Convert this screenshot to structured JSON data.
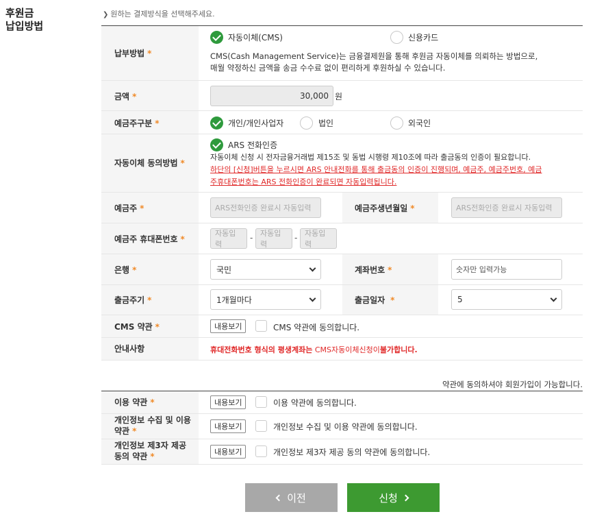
{
  "section_title_line1": "후원금",
  "section_title_line2": "납입방법",
  "hint": "원하는 결제방식을 선택해주세요.",
  "payment": {
    "label": "납부방법",
    "opt_cms": "자동이체(CMS)",
    "opt_card": "신용카드",
    "desc_line1": "CMS(Cash Management Service)는 금융결제원을 통해 후원금 자동이체를 의뢰하는 방법으로,",
    "desc_line2": "매월 약정하신 금액을 송금 수수료 없이 편리하게 후원하실 수 있습니다."
  },
  "amount": {
    "label": "금액",
    "value": "30,000",
    "unit": "원"
  },
  "depositor_type": {
    "label": "예금주구분",
    "opt_personal": "개인/개인사업자",
    "opt_corp": "법인",
    "opt_foreign": "외국인"
  },
  "consent_method": {
    "label": "자동이체 동의방법",
    "opt_ars": "ARS 전화인증",
    "desc": "자동이체 신청 시 전자금융거래법 제15조 및 동법 시행령 제10조에 따라 출금동의 인증이 필요합니다.",
    "warn_line1": "하단의 [신청]버튼을 누르시면 ARS 안내전화를 통해 출금동의 인증이 진행되며, 예금주, 예금주번호, 예금",
    "warn_line2": "주휴대폰번호는 ARS 전화인증이 완료되면 자동입력됩니다."
  },
  "holder": {
    "label": "예금주",
    "placeholder": "ARS전화인증 완료시 자동입력",
    "birth_label": "예금주생년월일",
    "birth_placeholder": "ARS전화인증 완료시 자동입력"
  },
  "phone": {
    "label": "예금주 휴대폰번호",
    "p1": "자동입력",
    "p2": "자동입력",
    "p3": "자동입력",
    "sep": "-"
  },
  "bank": {
    "label": "은행",
    "selected": "국민",
    "account_label": "계좌번호",
    "account_placeholder": "숫자만 입력가능"
  },
  "cycle": {
    "label": "출금주기",
    "selected": "1개월마다",
    "day_label": "출금일자",
    "day_selected": "5"
  },
  "cms_terms": {
    "label": "CMS 약관",
    "view": "내용보기",
    "agree": "CMS 약관에 동의합니다."
  },
  "notice": {
    "label": "안내사항",
    "part1": "휴대전화번호 형식의 평생계좌는",
    "part2": "CMS자동이체신청이",
    "part3": "불가합니다."
  },
  "terms_note": "약관에 동의하셔야 회원가입이 가능합니다.",
  "terms": [
    {
      "label": "이용 약관",
      "view": "내용보기",
      "agree": "이용 약관에 동의합니다."
    },
    {
      "label_line1": "개인정보 수집 및 이용",
      "label_line2": "약관",
      "view": "내용보기",
      "agree": "개인정보 수집 및 이용 약관에 동의합니다."
    },
    {
      "label_line1": "개인정보 제3자 제공",
      "label_line2": "동의 약관",
      "view": "내용보기",
      "agree": "개인정보 제3자 제공 동의 약관에 동의합니다."
    }
  ],
  "required_mark": "*",
  "buttons": {
    "prev": "이전",
    "next": "신청"
  },
  "colors": {
    "accent_green": "#3d9a31",
    "required_orange": "#f08a28",
    "warning_red": "#e02828"
  }
}
